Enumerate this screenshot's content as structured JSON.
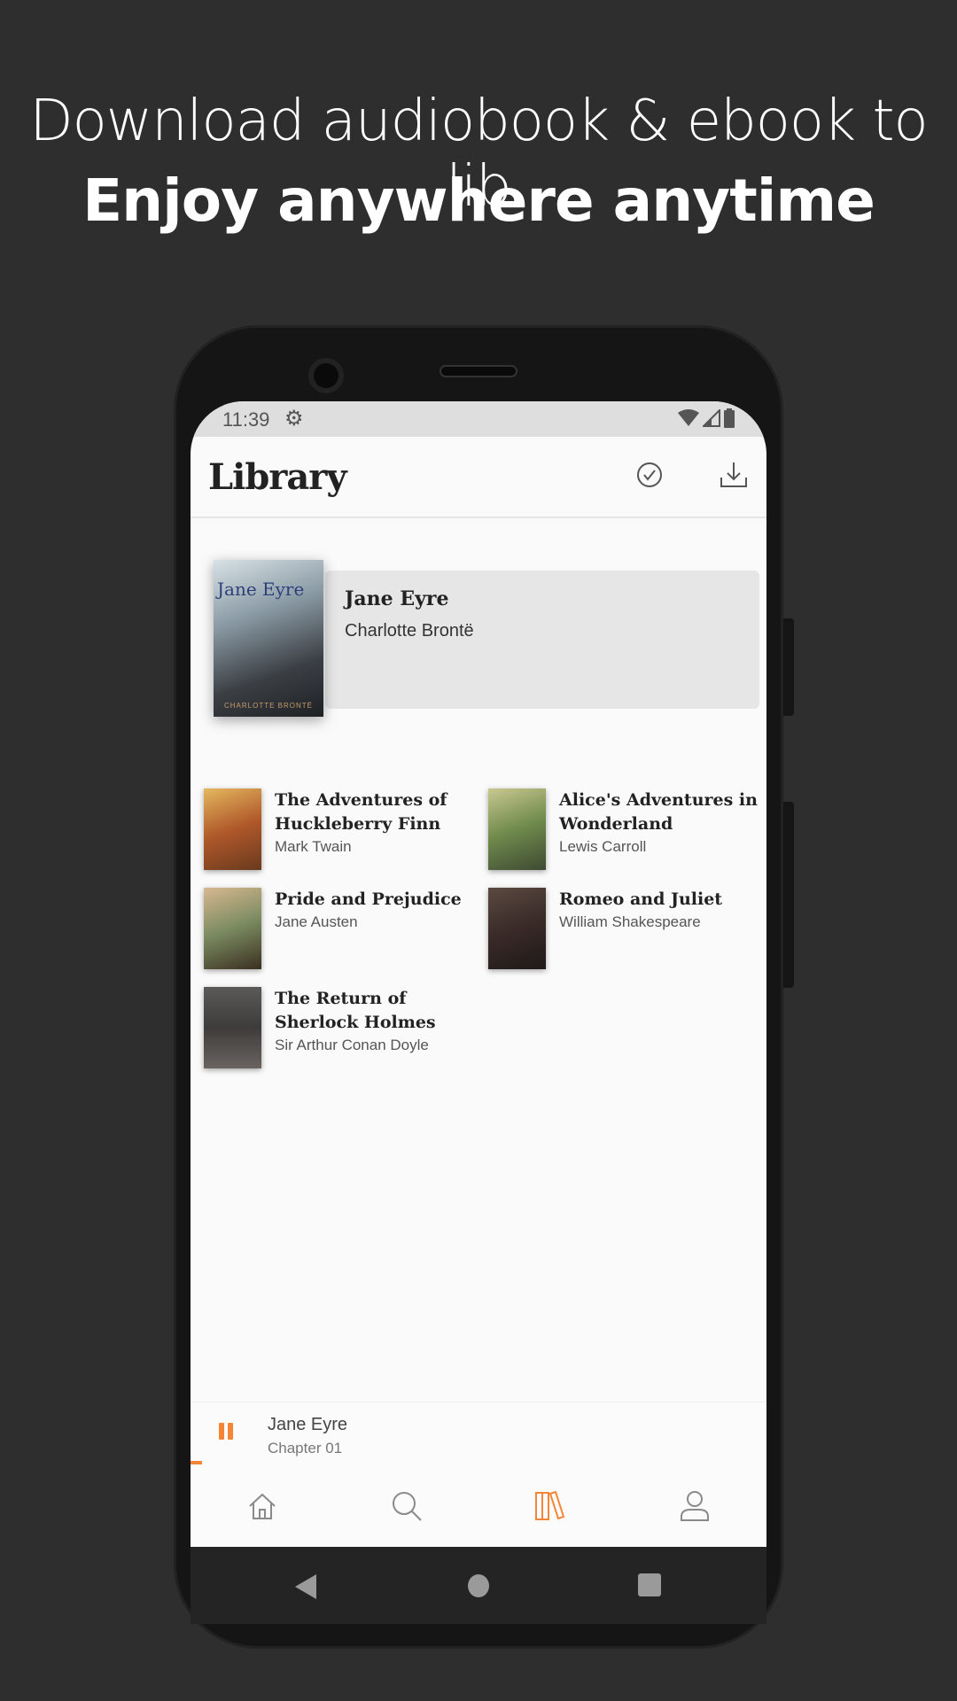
{
  "promo": {
    "line1": "Download audiobook & ebook to lib",
    "line2": "Enjoy anywhere anytime"
  },
  "status_bar": {
    "time": "11:39",
    "icons": [
      "gear-icon",
      "wifi-icon",
      "signal-icon",
      "battery-icon"
    ]
  },
  "header": {
    "title": "Library",
    "actions": [
      "check-circle-icon",
      "download-icon"
    ]
  },
  "featured": {
    "title": "Jane Eyre",
    "author": "Charlotte Brontë",
    "cover_title": "Jane Eyre",
    "cover_author": "CHARLOTTE BRONTË"
  },
  "books": [
    {
      "title": "The Adventures of Huckleberry Finn",
      "author": "Mark Twain"
    },
    {
      "title": "Alice's Adventures in Wonderland",
      "author": "Lewis Carroll"
    },
    {
      "title": "Pride and Prejudice",
      "author": "Jane Austen"
    },
    {
      "title": "Romeo and Juliet",
      "author": "William Shakespeare"
    },
    {
      "title": "The Return of Sherlock Holmes",
      "author": "Sir Arthur Conan Doyle"
    }
  ],
  "player": {
    "title": "Jane Eyre",
    "subtitle": "Chapter 01",
    "progress_percent": 2
  },
  "bottom_nav": {
    "items": [
      "home-icon",
      "search-icon",
      "library-icon",
      "profile-icon"
    ],
    "active": "library-icon"
  },
  "colors": {
    "accent": "#f58536",
    "background": "#2e2e2e"
  }
}
